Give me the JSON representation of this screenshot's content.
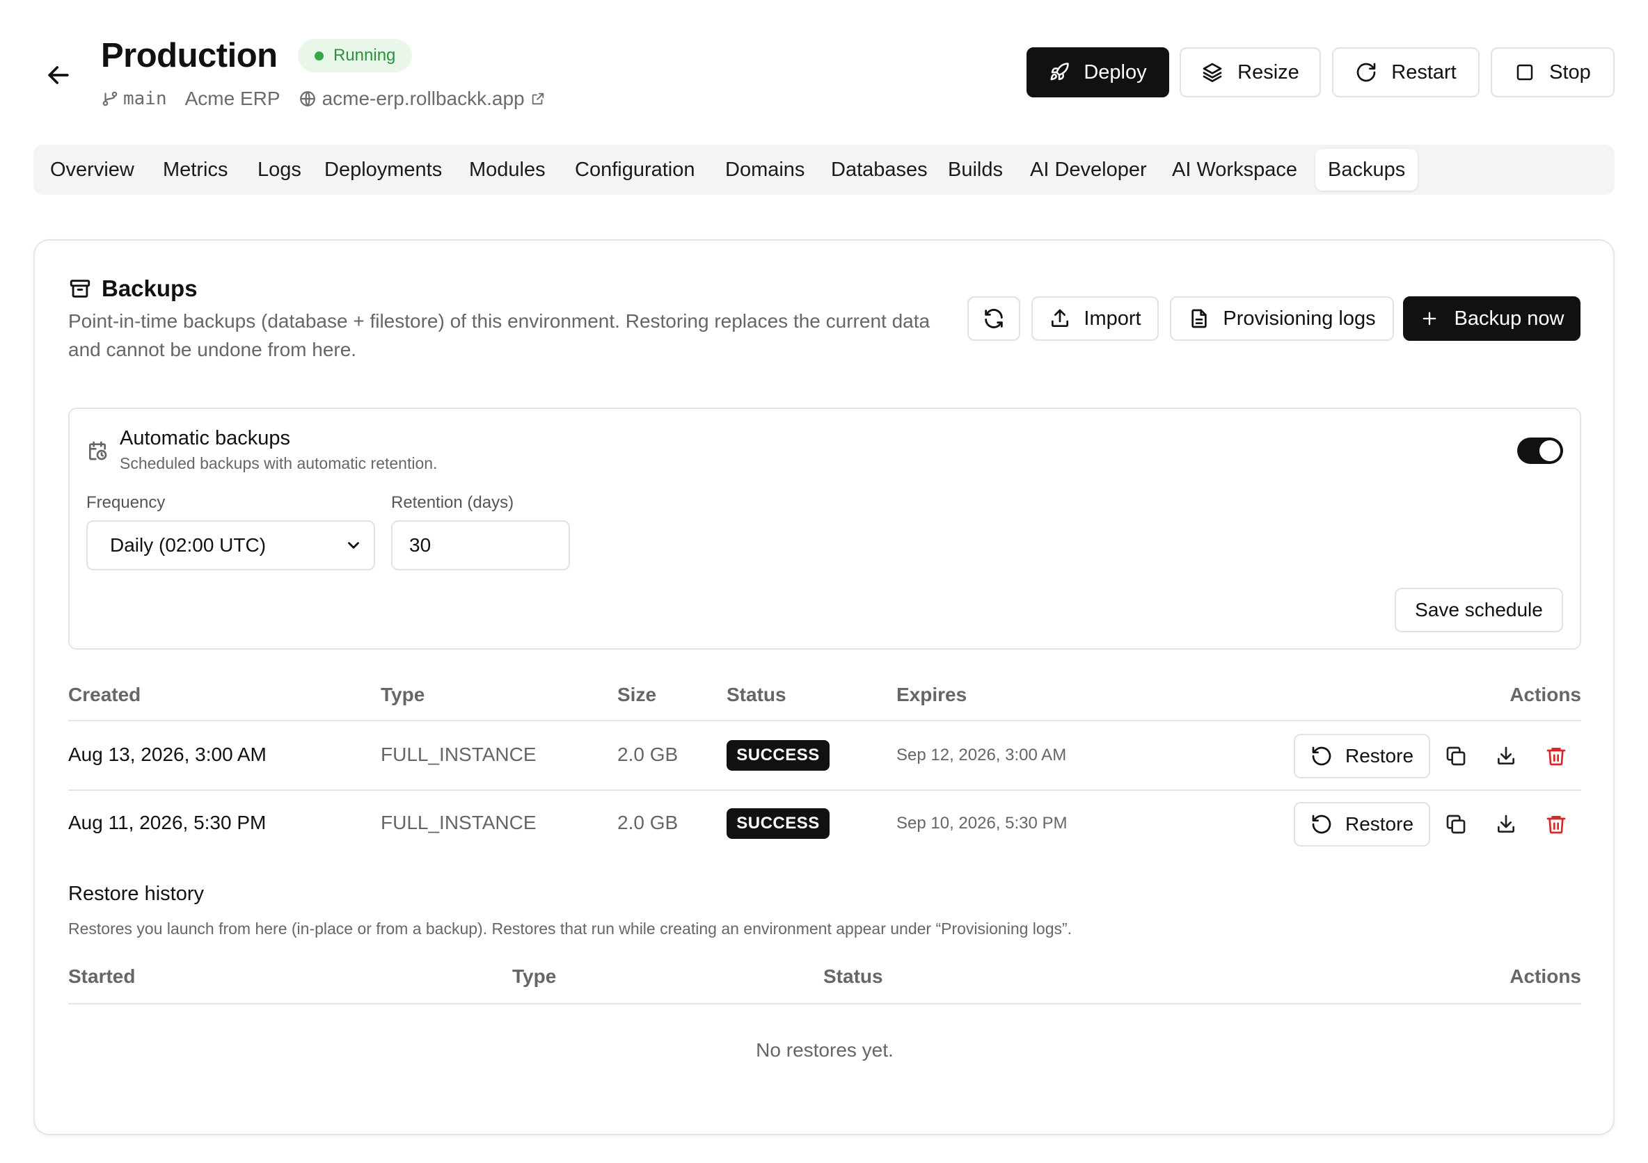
{
  "header": {
    "title": "Production",
    "status": "Running",
    "branch": "main",
    "project": "Acme ERP",
    "domain": "acme-erp.rollbackk.app",
    "actions": {
      "deploy": "Deploy",
      "resize": "Resize",
      "restart": "Restart",
      "stop": "Stop"
    }
  },
  "tabs": [
    "Overview",
    "Metrics",
    "Logs",
    "Deployments",
    "Modules",
    "Configuration",
    "Domains",
    "Databases",
    "Builds",
    "AI Developer",
    "AI Workspace",
    "Backups"
  ],
  "active_tab": "Backups",
  "backups": {
    "title": "Backups",
    "description": "Point-in-time backups (database + filestore) of this environment. Restoring replaces the current data and cannot be undone from here.",
    "buttons": {
      "import": "Import",
      "provisioning_logs": "Provisioning logs",
      "backup_now": "Backup now"
    },
    "automatic": {
      "title": "Automatic backups",
      "subtitle": "Scheduled backups with automatic retention.",
      "enabled": true,
      "frequency_label": "Frequency",
      "frequency_value": "Daily (02:00 UTC)",
      "retention_label": "Retention (days)",
      "retention_value": "30",
      "save_label": "Save schedule"
    },
    "table": {
      "headers": {
        "created": "Created",
        "type": "Type",
        "size": "Size",
        "status": "Status",
        "expires": "Expires",
        "actions": "Actions"
      },
      "rows": [
        {
          "created": "Aug 13, 2026, 3:00 AM",
          "type": "FULL_INSTANCE",
          "size": "2.0 GB",
          "status": "SUCCESS",
          "expires": "Sep 12, 2026, 3:00 AM",
          "restore": "Restore"
        },
        {
          "created": "Aug 11, 2026, 5:30 PM",
          "type": "FULL_INSTANCE",
          "size": "2.0 GB",
          "status": "SUCCESS",
          "expires": "Sep 10, 2026, 5:30 PM",
          "restore": "Restore"
        }
      ]
    }
  },
  "restore_history": {
    "title": "Restore history",
    "description": "Restores you launch from here (in-place or from a backup). Restores that run while creating an environment appear under “Provisioning logs”.",
    "headers": {
      "started": "Started",
      "type": "Type",
      "status": "Status",
      "actions": "Actions"
    },
    "empty": "No restores yet."
  },
  "colors": {
    "status_green": "#36a84a",
    "danger": "#dc2626",
    "primary": "#111111"
  }
}
